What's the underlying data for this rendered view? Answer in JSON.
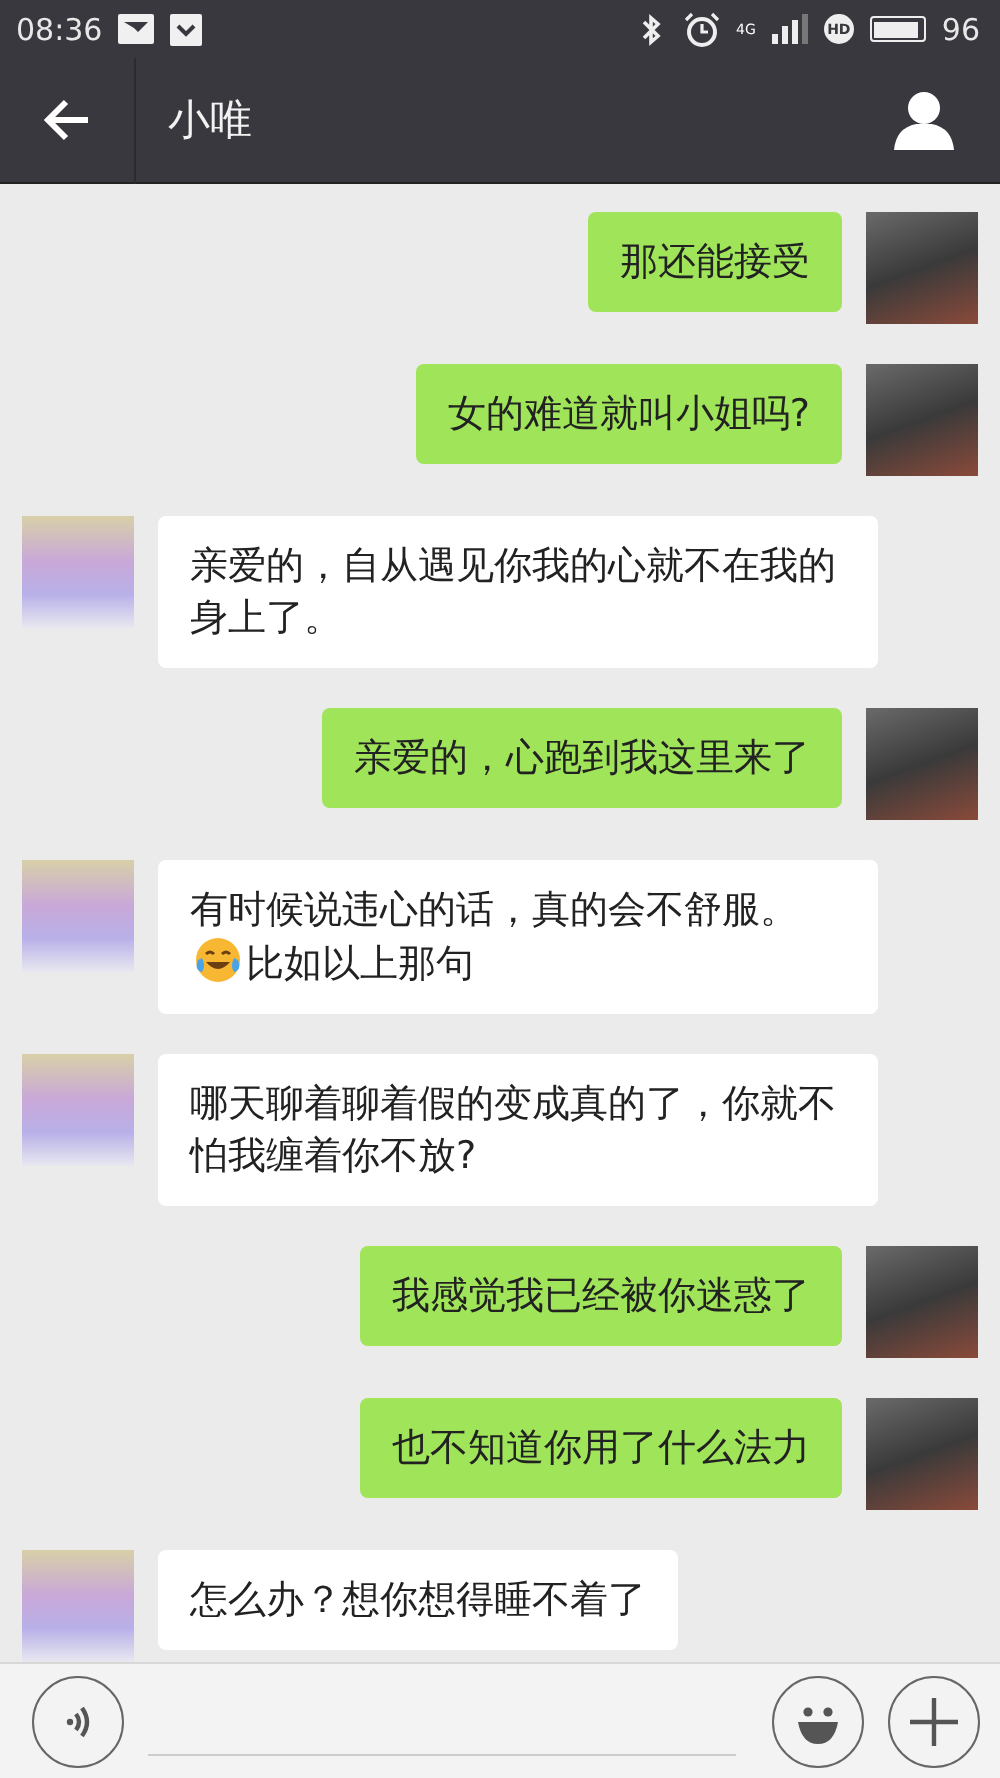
{
  "status_bar": {
    "time": "08:36",
    "network": "4G",
    "hd": "HD",
    "battery": {
      "level": 0.96,
      "text": "96"
    }
  },
  "header": {
    "title": "小唯"
  },
  "messages": [
    {
      "kind": "sent",
      "segments": [
        {
          "kind": "text",
          "text": "那还能接受"
        }
      ]
    },
    {
      "kind": "sent",
      "segments": [
        {
          "kind": "text",
          "text": "女的难道就叫小姐吗?"
        }
      ]
    },
    {
      "kind": "received",
      "segments": [
        {
          "kind": "text",
          "text": "亲爱的，自从遇见你我的心就不在我的身上了。"
        }
      ]
    },
    {
      "kind": "sent",
      "segments": [
        {
          "kind": "text",
          "text": "亲爱的，心跑到我这里来了"
        }
      ]
    },
    {
      "kind": "received",
      "segments": [
        {
          "kind": "text",
          "text": "有时候说违心的话，真的会不舒服。"
        },
        {
          "kind": "emoji"
        },
        {
          "kind": "text",
          "text": "比如以上那句"
        }
      ]
    },
    {
      "kind": "received",
      "segments": [
        {
          "kind": "text",
          "text": "哪天聊着聊着假的变成真的了，你就不怕我缠着你不放?"
        }
      ]
    },
    {
      "kind": "sent",
      "segments": [
        {
          "kind": "text",
          "text": "我感觉我已经被你迷惑了"
        }
      ]
    },
    {
      "kind": "sent",
      "segments": [
        {
          "kind": "text",
          "text": "也不知道你用了什么法力"
        }
      ]
    },
    {
      "kind": "received",
      "segments": [
        {
          "kind": "text",
          "text": "怎么办？想你想得睡不着了"
        }
      ]
    }
  ]
}
